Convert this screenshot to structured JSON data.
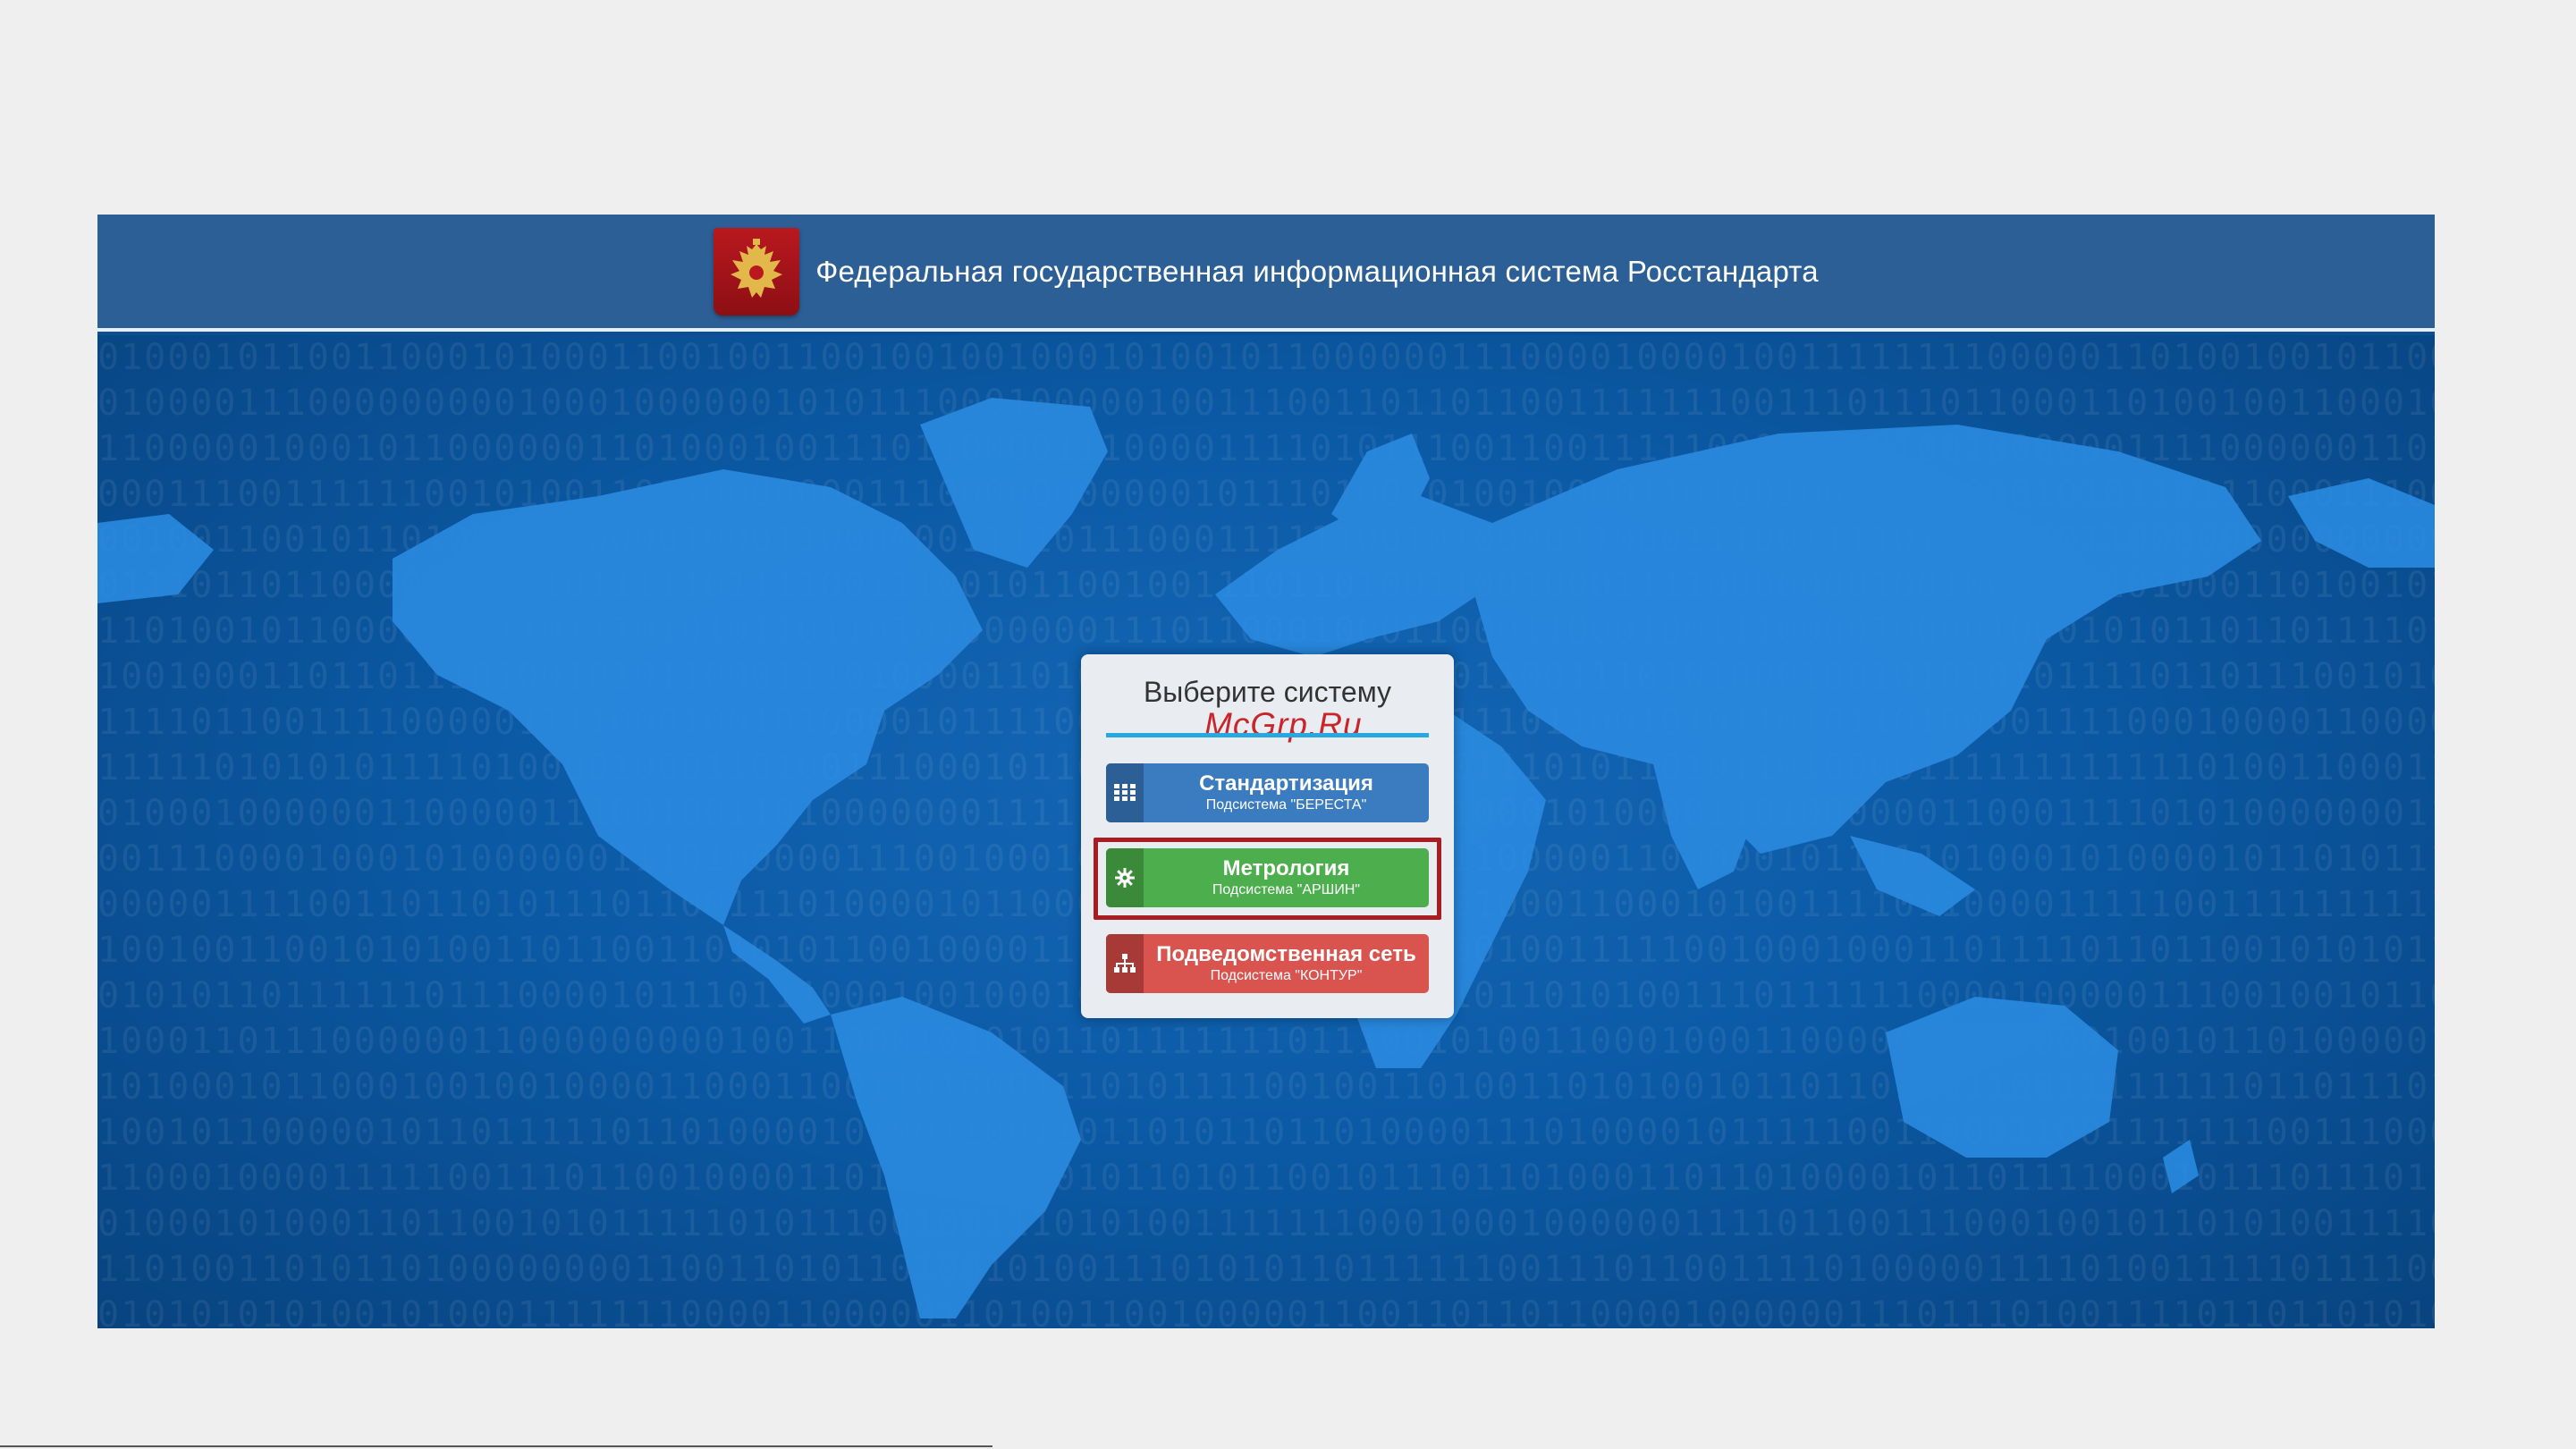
{
  "header": {
    "title": "Федеральная государственная информационная система Росстандарта",
    "emblem_icon": "russian-coat-of-arms-icon"
  },
  "dialog": {
    "title": "Выберите систему",
    "watermark": "McGrp.Ru",
    "buttons": [
      {
        "label": "Стандартизация",
        "sublabel": "Подсистема \"БЕРЕСТА\"",
        "icon": "grid-icon",
        "color": "#3b7cc0"
      },
      {
        "label": "Метрология",
        "sublabel": "Подсистема \"АРШИН\"",
        "icon": "gear-icon",
        "color": "#4cae4c",
        "highlighted": true
      },
      {
        "label": "Подведомственная сеть",
        "sublabel": "Подсистема \"КОНТУР\"",
        "icon": "hierarchy-icon",
        "color": "#d9534f"
      }
    ]
  },
  "colors": {
    "header_bg": "#2c5f96",
    "map_bg": "#0b5aa6",
    "highlight_border": "#a81c22",
    "divider": "#27a8e0"
  }
}
